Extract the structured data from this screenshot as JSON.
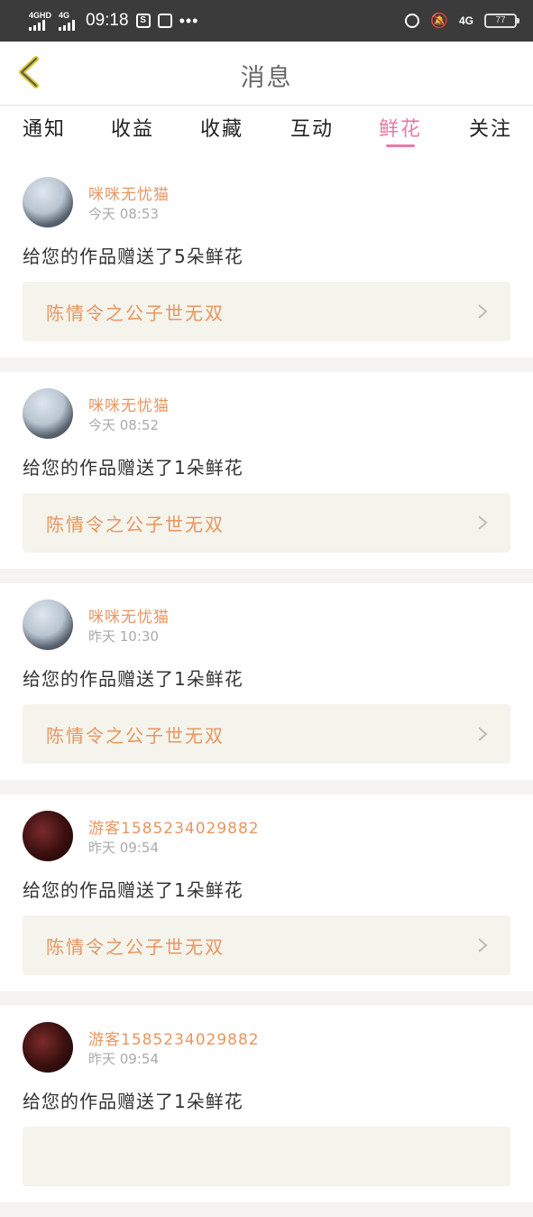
{
  "status_bar": {
    "network1": "4GHD",
    "network2": "4G",
    "time": "09:18",
    "icon1": "S",
    "dots": "•••",
    "net_right": "4G",
    "battery": "77"
  },
  "header": {
    "title": "消息"
  },
  "tabs": [
    {
      "label": "通知"
    },
    {
      "label": "收益"
    },
    {
      "label": "收藏"
    },
    {
      "label": "互动"
    },
    {
      "label": "鲜花"
    },
    {
      "label": "关注"
    }
  ],
  "active_tab": "鲜花",
  "colors": {
    "accent": "#e77aa6",
    "name": "#e8955f",
    "card_bg": "#f4f4ec"
  },
  "messages": [
    {
      "user": "咪咪无忧猫",
      "time": "今天 08:53",
      "text": "给您的作品赠送了5朵鲜花",
      "work": "陈情令之公子世无双"
    },
    {
      "user": "咪咪无忧猫",
      "time": "今天 08:52",
      "text": "给您的作品赠送了1朵鲜花",
      "work": "陈情令之公子世无双"
    },
    {
      "user": "咪咪无忧猫",
      "time": "昨天 10:30",
      "text": "给您的作品赠送了1朵鲜花",
      "work": "陈情令之公子世无双"
    },
    {
      "user": "游客1585234029882",
      "time": "昨天 09:54",
      "text": "给您的作品赠送了1朵鲜花",
      "work": "陈情令之公子世无双"
    },
    {
      "user": "游客1585234029882",
      "time": "昨天 09:54",
      "text": "给您的作品赠送了1朵鲜花",
      "work": ""
    }
  ]
}
